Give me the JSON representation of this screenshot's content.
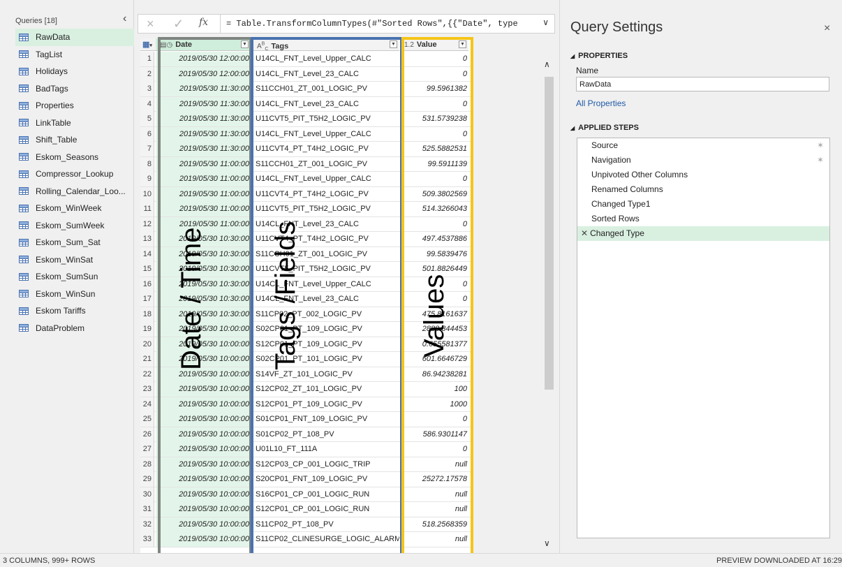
{
  "queries": {
    "header": "Queries [18]",
    "items": [
      {
        "label": "RawData",
        "selected": true
      },
      {
        "label": "TagList"
      },
      {
        "label": "Holidays"
      },
      {
        "label": "BadTags"
      },
      {
        "label": "Properties"
      },
      {
        "label": "LinkTable"
      },
      {
        "label": "Shift_Table"
      },
      {
        "label": "Eskom_Seasons"
      },
      {
        "label": "Compressor_Lookup"
      },
      {
        "label": "Rolling_Calendar_Loo..."
      },
      {
        "label": "Eskom_WinWeek"
      },
      {
        "label": "Eskom_SumWeek"
      },
      {
        "label": "Eskom_Sum_Sat"
      },
      {
        "label": "Eskom_WinSat"
      },
      {
        "label": "Eskom_SumSun"
      },
      {
        "label": "Eskom_WinSun"
      },
      {
        "label": "Eskom Tariffs"
      },
      {
        "label": "DataProblem"
      }
    ]
  },
  "formula_bar": {
    "cancel_icon": "×",
    "accept_icon": "✓",
    "fx_label": "fx",
    "formula": "= Table.TransformColumnTypes(#\"Sorted Rows\",{{\"Date\", type",
    "expand_icon": "chevron-down-icon"
  },
  "grid": {
    "columns": [
      {
        "type_icon": "datetime",
        "label": "Date"
      },
      {
        "type_icon": "ABC",
        "label": "Tags"
      },
      {
        "type_icon": "1.2",
        "label": "Value"
      }
    ],
    "rows": [
      [
        "1",
        "2019/05/30 12:00:00",
        "U14CL_FNT_Level_Upper_CALC",
        "0"
      ],
      [
        "2",
        "2019/05/30 12:00:00",
        "U14CL_FNT_Level_23_CALC",
        "0"
      ],
      [
        "3",
        "2019/05/30 11:30:00",
        "S11CCH01_ZT_001_LOGIC_PV",
        "99.5961382"
      ],
      [
        "4",
        "2019/05/30 11:30:00",
        "U14CL_FNT_Level_23_CALC",
        "0"
      ],
      [
        "5",
        "2019/05/30 11:30:00",
        "U11CVT5_PIT_T5H2_LOGIC_PV",
        "531.5739238"
      ],
      [
        "6",
        "2019/05/30 11:30:00",
        "U14CL_FNT_Level_Upper_CALC",
        "0"
      ],
      [
        "7",
        "2019/05/30 11:30:00",
        "U11CVT4_PT_T4H2_LOGIC_PV",
        "525.5882531"
      ],
      [
        "8",
        "2019/05/30 11:00:00",
        "S11CCH01_ZT_001_LOGIC_PV",
        "99.5911139"
      ],
      [
        "9",
        "2019/05/30 11:00:00",
        "U14CL_FNT_Level_Upper_CALC",
        "0"
      ],
      [
        "10",
        "2019/05/30 11:00:00",
        "U11CVT4_PT_T4H2_LOGIC_PV",
        "509.3802569"
      ],
      [
        "11",
        "2019/05/30 11:00:00",
        "U11CVT5_PIT_T5H2_LOGIC_PV",
        "514.3266043"
      ],
      [
        "12",
        "2019/05/30 11:00:00",
        "U14CL_FNT_Level_23_CALC",
        "0"
      ],
      [
        "13",
        "2019/05/30 10:30:00",
        "U11CVT4_PT_T4H2_LOGIC_PV",
        "497.4537886"
      ],
      [
        "14",
        "2019/05/30 10:30:00",
        "S11CCH01_ZT_001_LOGIC_PV",
        "99.5839476"
      ],
      [
        "15",
        "2019/05/30 10:30:00",
        "U11CVT5_PIT_T5H2_LOGIC_PV",
        "501.8826449"
      ],
      [
        "16",
        "2019/05/30 10:30:00",
        "U14CL_FNT_Level_Upper_CALC",
        "0"
      ],
      [
        "17",
        "2019/05/30 10:30:00",
        "U14CL_FNT_Level_23_CALC",
        "0"
      ],
      [
        "18",
        "2019/05/30 10:30:00",
        "S11CP02_PT_002_LOGIC_PV",
        "475.8161637"
      ],
      [
        "19",
        "2019/05/30 10:00:00",
        "S02CP01_PT_109_LOGIC_PV",
        "2888.844453"
      ],
      [
        "20",
        "2019/05/30 10:00:00",
        "S12CP01_PT_109_LOGIC_PV",
        "0.655581377"
      ],
      [
        "21",
        "2019/05/30 10:00:00",
        "S02CP01_PT_101_LOGIC_PV",
        "601.6646729"
      ],
      [
        "22",
        "2019/05/30 10:00:00",
        "S14VF_ZT_101_LOGIC_PV",
        "86.94238281"
      ],
      [
        "23",
        "2019/05/30 10:00:00",
        "S12CP02_ZT_101_LOGIC_PV",
        "100"
      ],
      [
        "24",
        "2019/05/30 10:00:00",
        "S12CP01_PT_109_LOGIC_PV",
        "1000"
      ],
      [
        "25",
        "2019/05/30 10:00:00",
        "S01CP01_FNT_109_LOGIC_PV",
        "0"
      ],
      [
        "26",
        "2019/05/30 10:00:00",
        "S01CP02_PT_108_PV",
        "586.9301147"
      ],
      [
        "27",
        "2019/05/30 10:00:00",
        "U01L10_FT_111A",
        "0"
      ],
      [
        "28",
        "2019/05/30 10:00:00",
        "S12CP03_CP_001_LOGIC_TRIP",
        "null"
      ],
      [
        "29",
        "2019/05/30 10:00:00",
        "S20CP01_FNT_109_LOGIC_PV",
        "25272.17578"
      ],
      [
        "30",
        "2019/05/30 10:00:00",
        "S16CP01_CP_001_LOGIC_RUN",
        "null"
      ],
      [
        "31",
        "2019/05/30 10:00:00",
        "S12CP01_CP_001_LOGIC_RUN",
        "null"
      ],
      [
        "32",
        "2019/05/30 10:00:00",
        "S11CP02_PT_108_PV",
        "518.2568359"
      ],
      [
        "33",
        "2019/05/30 10:00:00",
        "S11CP02_CLINESURGE_LOGIC_ALARM",
        "null"
      ]
    ],
    "overlay_labels": {
      "date": "Date / Time",
      "tags": "Tags /Fields",
      "values": "Values"
    },
    "highlight_colors": {
      "date": "#7f8581",
      "tags": "#4a72b0",
      "values": "#f5c518"
    }
  },
  "settings": {
    "title": "Query Settings",
    "close_icon": "×",
    "properties_header": "PROPERTIES",
    "name_label": "Name",
    "name_value": "RawData",
    "all_properties": "All Properties",
    "applied_steps_header": "APPLIED STEPS",
    "steps": [
      {
        "label": "Source",
        "gear": true
      },
      {
        "label": "Navigation",
        "gear": true
      },
      {
        "label": "Unpivoted Other Columns"
      },
      {
        "label": "Renamed Columns"
      },
      {
        "label": "Changed Type1"
      },
      {
        "label": "Sorted Rows"
      },
      {
        "label": "Changed Type",
        "selected": true
      }
    ]
  },
  "status": {
    "left": "3 COLUMNS, 999+ ROWS",
    "right": "PREVIEW DOWNLOADED AT 16:29"
  }
}
